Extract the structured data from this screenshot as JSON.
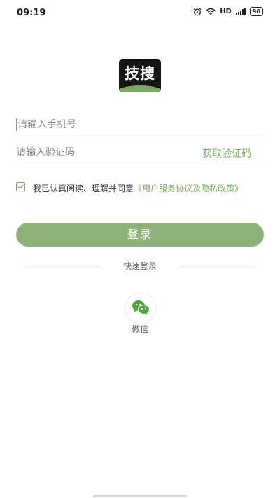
{
  "status_bar": {
    "time": "09:19",
    "network_label": "HD",
    "signal_label": "4G",
    "battery_level": "90"
  },
  "logo": {
    "text": "技搜",
    "background_color": "#141414",
    "accent_color": "#7fa865"
  },
  "form": {
    "phone_placeholder": "请输入手机号",
    "phone_value": "",
    "code_placeholder": "请输入验证码",
    "code_value": "",
    "get_code_label": "获取验证码"
  },
  "agreement": {
    "checked": true,
    "text": "我已认真阅读、理解并同意",
    "link_text": "《用户服务协议及隐私政策》"
  },
  "login_button": {
    "label": "登录",
    "color": "#8fb17c"
  },
  "quick_login": {
    "title": "快速登录",
    "options": [
      {
        "icon": "wechat-icon",
        "label": "微信"
      }
    ]
  }
}
